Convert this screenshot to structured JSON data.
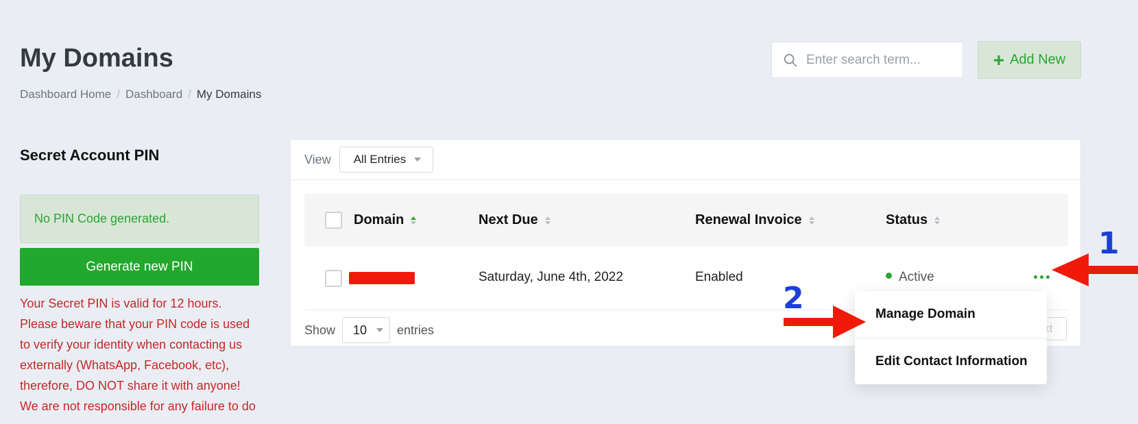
{
  "header": {
    "title": "My Domains",
    "breadcrumb": [
      "Dashboard Home",
      "Dashboard",
      "My Domains"
    ],
    "search_placeholder": "Enter search term...",
    "add_new_label": "Add New"
  },
  "pin": {
    "title": "Secret Account PIN",
    "alert": "No PIN Code generated.",
    "button": "Generate new PIN",
    "warning": "Your Secret PIN is valid for 12 hours. Please beware that your PIN code is used to verify your identity when contacting us externally (WhatsApp, Facebook, etc), therefore, DO NOT share it with anyone! We are not responsible for any failure to do"
  },
  "table": {
    "view_label": "View",
    "view_selected": "All Entries",
    "columns": [
      "Domain",
      "Next Due",
      "Renewal Invoice",
      "Status"
    ],
    "rows": [
      {
        "domain": "[redacted]",
        "next_due": "Saturday, June 4th, 2022",
        "renewal_invoice": "Enabled",
        "status": "Active"
      }
    ],
    "show_label": "Show",
    "show_value": "10",
    "entries_label": "entries",
    "next_label": "Next"
  },
  "dropdown": {
    "items": [
      "Manage Domain",
      "Edit Contact Information"
    ]
  },
  "annotations": {
    "step1": "1",
    "step2": "2"
  },
  "colors": {
    "accent_green": "#2aa532",
    "warning_red": "#c62828",
    "arrow_red": "#f01a0b",
    "annotation_blue": "#1c3fd8"
  }
}
